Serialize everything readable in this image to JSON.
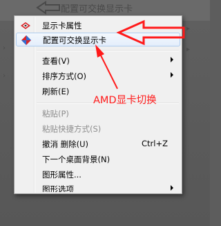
{
  "background": {
    "faded_menu_item": "配置可交换显示卡"
  },
  "context_menu": {
    "items": [
      {
        "label": "显示卡属性",
        "icon": "amd-catalyst-icon",
        "enabled": true,
        "submenu": false
      },
      {
        "label": "配置可交换显示卡",
        "icon": "amd-switchable-graphics-icon",
        "enabled": true,
        "submenu": false,
        "highlighted": true
      },
      {
        "label": "查看(V)",
        "enabled": true,
        "submenu": true
      },
      {
        "label": "排序方式(O)",
        "enabled": true,
        "submenu": true
      },
      {
        "label": "刷新(E)",
        "enabled": true,
        "submenu": false
      },
      {
        "label": "粘贴(P)",
        "enabled": false,
        "submenu": false
      },
      {
        "label": "粘贴快捷方式(S)",
        "enabled": false,
        "submenu": false
      },
      {
        "label": "撤消 删除(U)",
        "shortcut": "Ctrl+Z",
        "enabled": true,
        "submenu": false
      },
      {
        "label": "下一个桌面背景(N)",
        "enabled": true,
        "submenu": false
      },
      {
        "label": "图形属性...",
        "enabled": true,
        "submenu": false
      },
      {
        "label": "图形选项",
        "enabled": true,
        "submenu": true,
        "partially_visible": true
      }
    ]
  },
  "annotation": {
    "text": "AMD显卡切换",
    "color": "#ff1a1a"
  }
}
